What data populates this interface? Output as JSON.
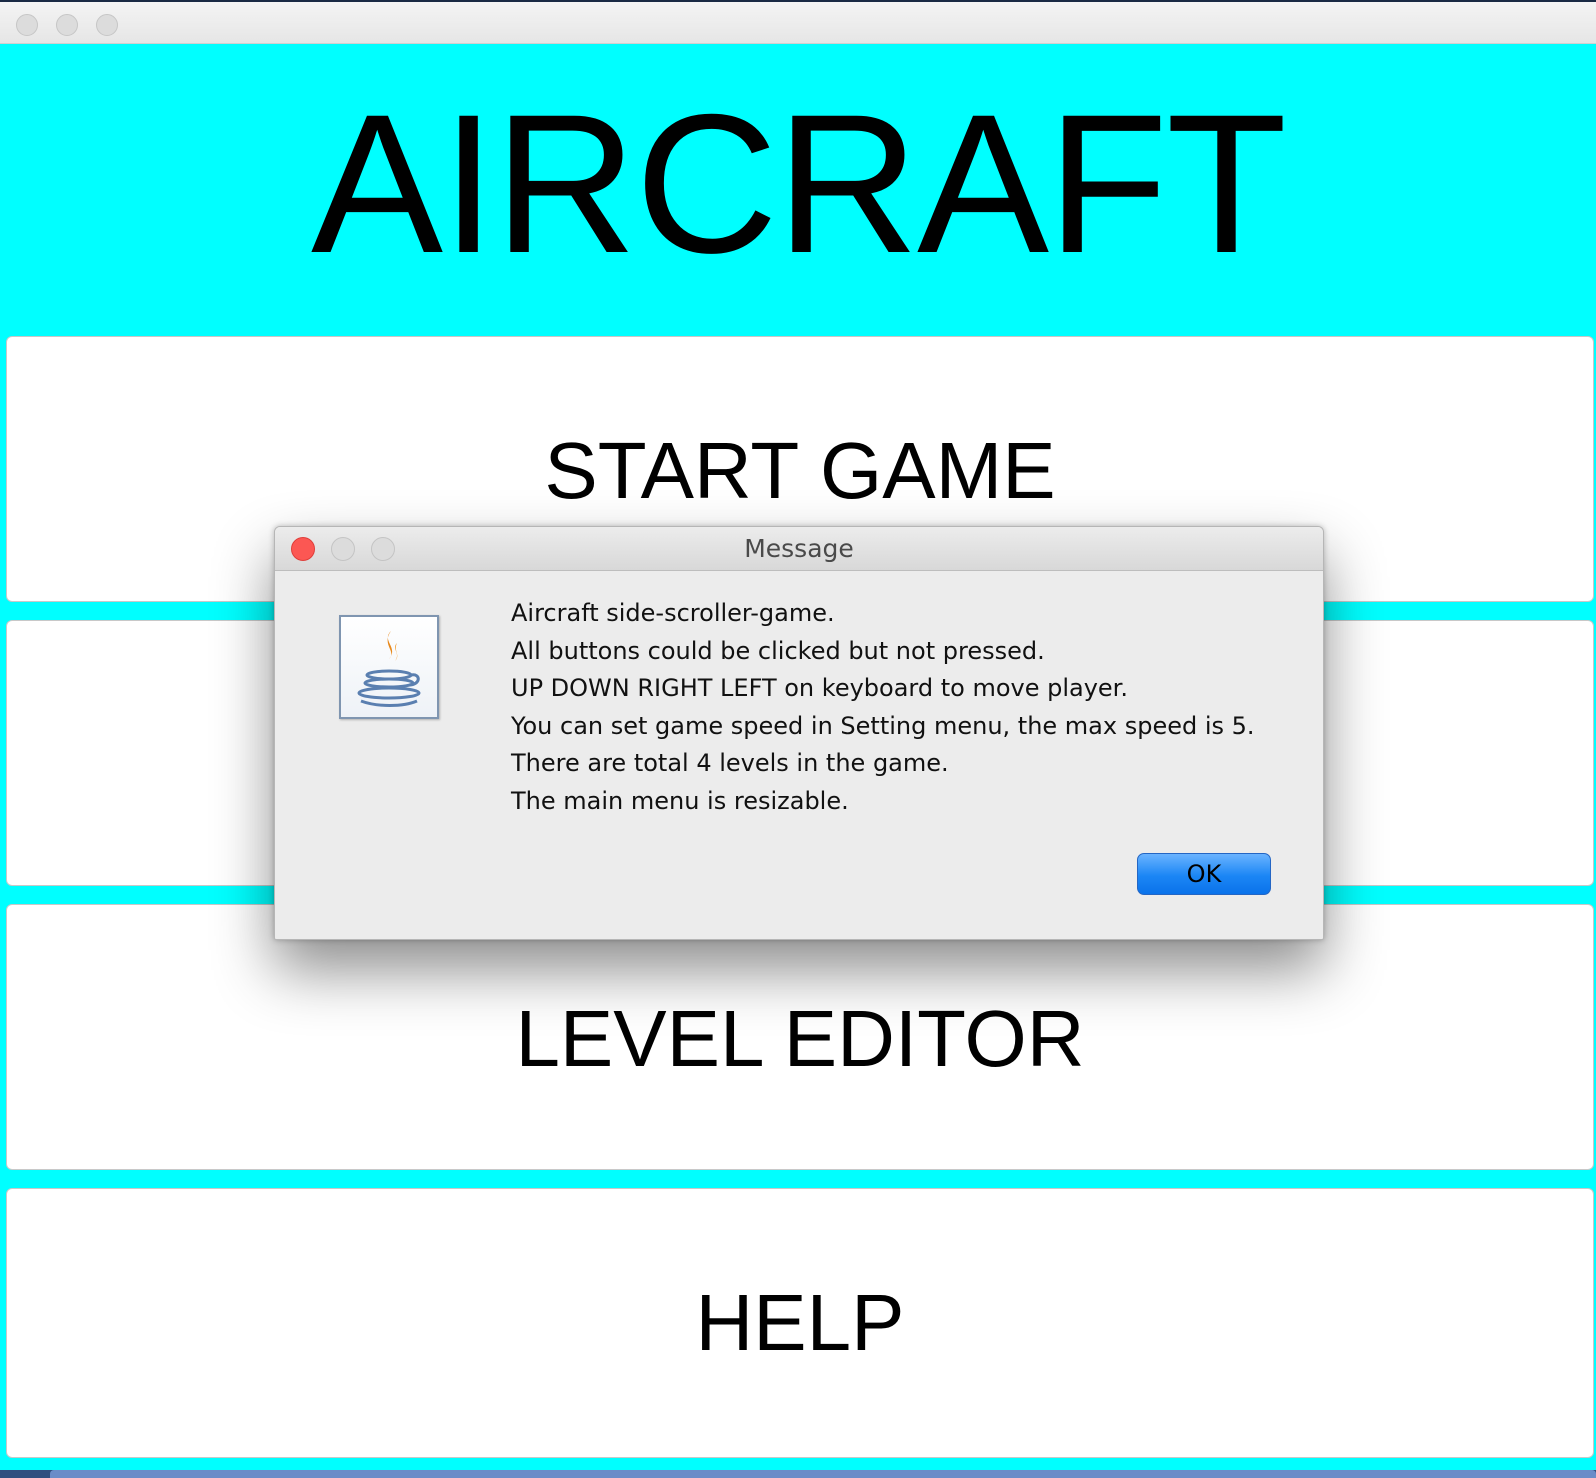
{
  "window": {
    "background_color": "#00ffff"
  },
  "main_menu": {
    "title": "AIRCRAFT",
    "buttons": [
      {
        "label": "START GAME"
      },
      {
        "label": ""
      },
      {
        "label": "LEVEL EDITOR"
      },
      {
        "label": "HELP"
      }
    ]
  },
  "dialog": {
    "title": "Message",
    "icon": "java-cup-icon",
    "lines": [
      "Aircraft side-scroller-game.",
      "All buttons could be clicked but not pressed.",
      "UP DOWN RIGHT LEFT on keyboard to move player.",
      "You can set game speed in Setting menu, the max speed is 5.",
      "There are total 4 levels in the game.",
      "The main menu is resizable."
    ],
    "ok_label": "OK",
    "ok_color": "#1b86f5",
    "close_color": "#fc5753"
  }
}
